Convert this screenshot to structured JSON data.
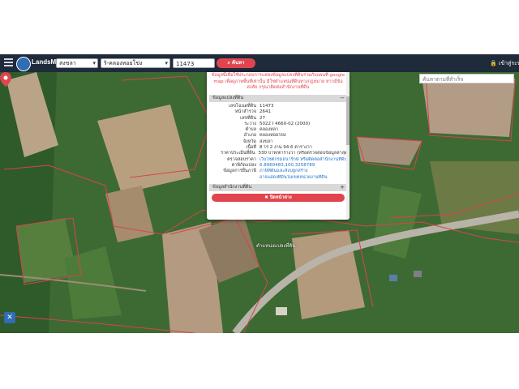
{
  "app": {
    "brand": "LandsMaps"
  },
  "navbar": {
    "province": "สงขลา",
    "district": "ริ-คลองหอยโข่ง",
    "parcel_no": "11473",
    "search_label": "ค้นหา",
    "login_label": "เข้าสู่ระบบ/ส"
  },
  "map": {
    "search_placeholder": "ค้นหาตามที่สำเร็จ",
    "marker_label": "ตำแหน่งแปลงที่ดิน"
  },
  "popup": {
    "notice": "ข้อมูลนี้เพื่อใช้ประกอบการแสดงข้อมูลแปลงที่ดินร่วมกับแผนที่ google map เพื่อดูภาพพื้นที่เท่านั้น มิใช่ตำแหน่งที่ดินทางกฎหมาย หากมีข้อสงสัย กรุณาติดต่อสำนักงานที่ดิน",
    "section1_title": "ข้อมูลแปลงที่ดิน",
    "section1_toggle": "−",
    "fields": [
      {
        "label": "เลขโฉนดที่ดิน",
        "value": "11473"
      },
      {
        "label": "หน้าสำรวจ",
        "value": "2641"
      },
      {
        "label": "เลขที่ดิน",
        "value": "27"
      },
      {
        "label": "ระวาง",
        "value": "5022 I 4660-02 (2000)"
      },
      {
        "label": "ตำบล",
        "value": "คลองหลา"
      },
      {
        "label": "อำเภอ",
        "value": "คลองหอยโข่ง"
      },
      {
        "label": "จังหวัด",
        "value": "สงขลา"
      },
      {
        "label": "เนื้อที่",
        "value": "8 ไร่ 2 งาน 94.6 ตารางวา"
      },
      {
        "label": "ราคาประเมินที่ดิน",
        "value": "530 บาท/ตารางวา (หรือตรวจสอบข้อมูลล่าสุด)"
      },
      {
        "label": "ตรวจสอบราคา",
        "value": "เว็บไซต์กรมธนารักษ์ หรือติดต่อสำนักงานที่ดิน"
      },
      {
        "label": "ค่าพิกัดแปลง",
        "value": "6.8960483,100.3258789"
      },
      {
        "label": "ข้อมูลการยื่นภาษี",
        "value": "ภาษีที่ดินและสิ่งปลูกสร้าง"
      }
    ],
    "field_extra": "อาจแสดงที่ดินในเขตหน่วยงานที่ดิน",
    "section2_title": "ข้อมูลสำนักงานที่ดิน",
    "section2_toggle": "+",
    "share_label": "ปิดหน้าต่าง"
  },
  "colors": {
    "accent": "#e0454e",
    "navbar": "#1f2a3a",
    "link": "#1e73c8"
  }
}
